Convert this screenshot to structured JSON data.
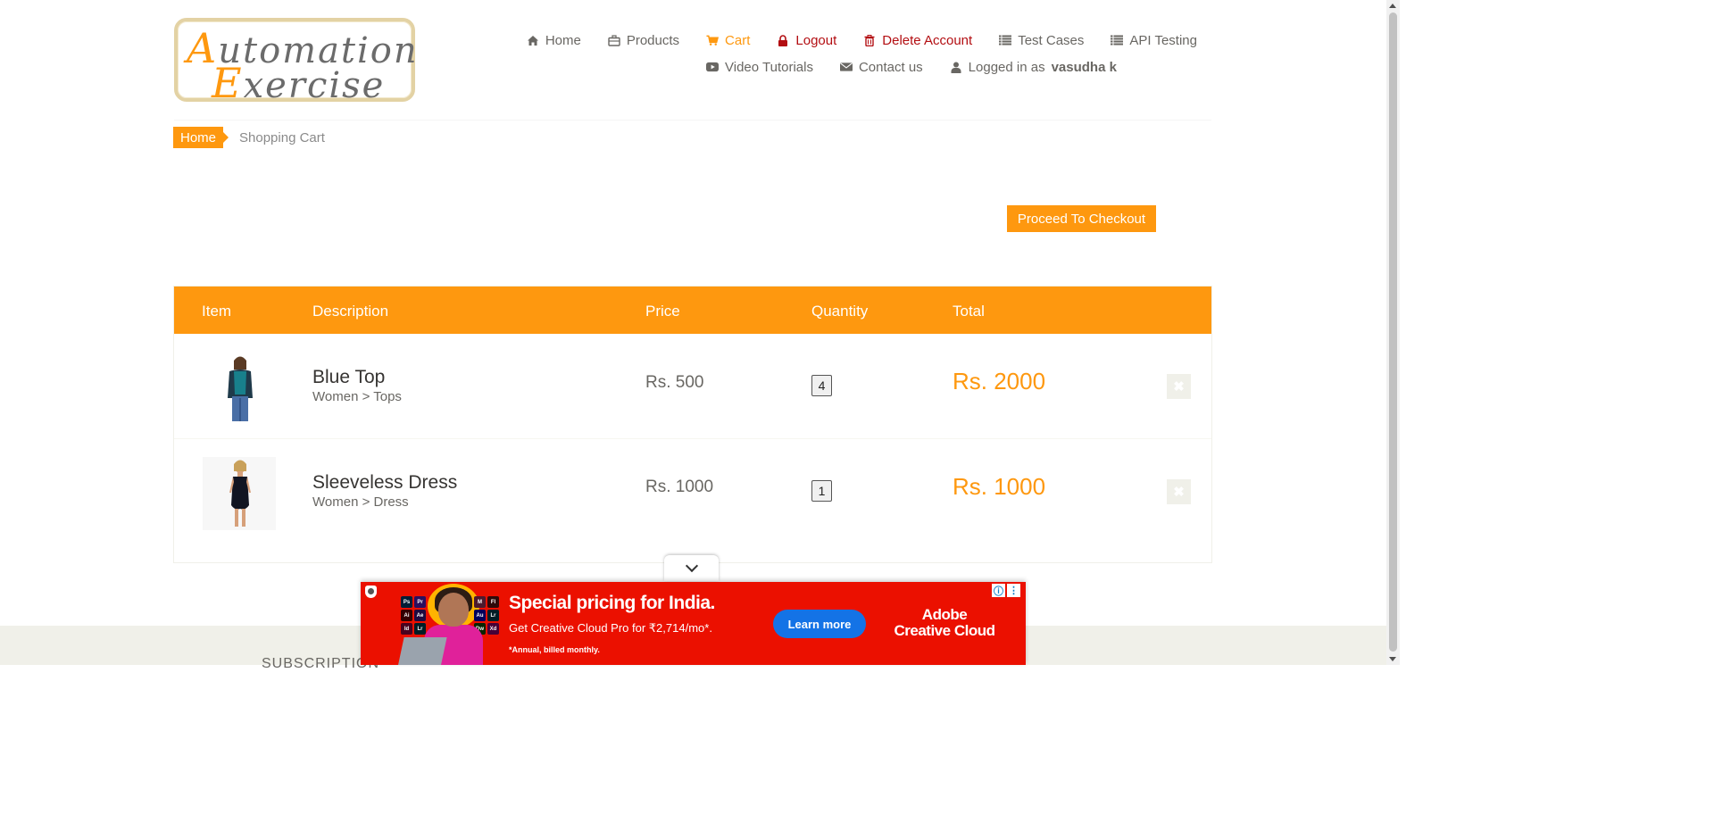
{
  "logo": {
    "line1_cap": "A",
    "line1_rest": "utomation",
    "line2_cap": "E",
    "line2_rest": "xercise"
  },
  "nav": {
    "row1": [
      {
        "label": "Home",
        "icon": "home-icon"
      },
      {
        "label": "Products",
        "icon": "briefcase-icon"
      },
      {
        "label": "Cart",
        "icon": "cart-icon"
      },
      {
        "label": "Logout",
        "icon": "lock-icon"
      },
      {
        "label": "Delete Account",
        "icon": "trash-icon"
      },
      {
        "label": "Test Cases",
        "icon": "list-icon"
      },
      {
        "label": "API Testing",
        "icon": "list-icon"
      }
    ],
    "row2": [
      {
        "label": "Video Tutorials",
        "icon": "youtube-icon"
      },
      {
        "label": "Contact us",
        "icon": "envelope-icon"
      },
      {
        "label_prefix": "Logged in as",
        "username": "vasudha k",
        "icon": "user-icon"
      }
    ],
    "active_color": "#FE980F",
    "danger_color": "#B30E12"
  },
  "breadcrumb": {
    "home": "Home",
    "current": "Shopping Cart"
  },
  "checkout": {
    "label": "Proceed To Checkout"
  },
  "cart": {
    "headers": {
      "item": "Item",
      "description": "Description",
      "price": "Price",
      "quantity": "Quantity",
      "total": "Total"
    },
    "rows": [
      {
        "name": "Blue Top",
        "category": "Women > Tops",
        "price": "Rs. 500",
        "quantity": "4",
        "total": "Rs. 2000",
        "delete": "✖"
      },
      {
        "name": "Sleeveless Dress",
        "category": "Women > Dress",
        "price": "Rs. 1000",
        "quantity": "1",
        "total": "Rs. 1000",
        "delete": "✖"
      }
    ]
  },
  "footer": {
    "subscription": "SUBSCRIPTION"
  },
  "ad": {
    "headline": "Special pricing for India.",
    "sub": "Get Creative Cloud Pro for ₹2,714/mo*.",
    "fine": "*Annual, billed monthly.",
    "cta": "Learn more",
    "brand_line1": "Adobe",
    "brand_line2": "Creative Cloud",
    "info_icon": "ⓘ",
    "menu_icon": "⋮",
    "apps_left": [
      "Ps",
      "Pr",
      "Ai",
      "Ae",
      "Id",
      "Lr"
    ],
    "apps_right": [
      "M",
      "Fl",
      "Au",
      "Lr",
      "Dw",
      "Xd"
    ],
    "bg_color": "#EB1000",
    "cta_color": "#1473E6"
  },
  "brand_color": "#FE980F"
}
